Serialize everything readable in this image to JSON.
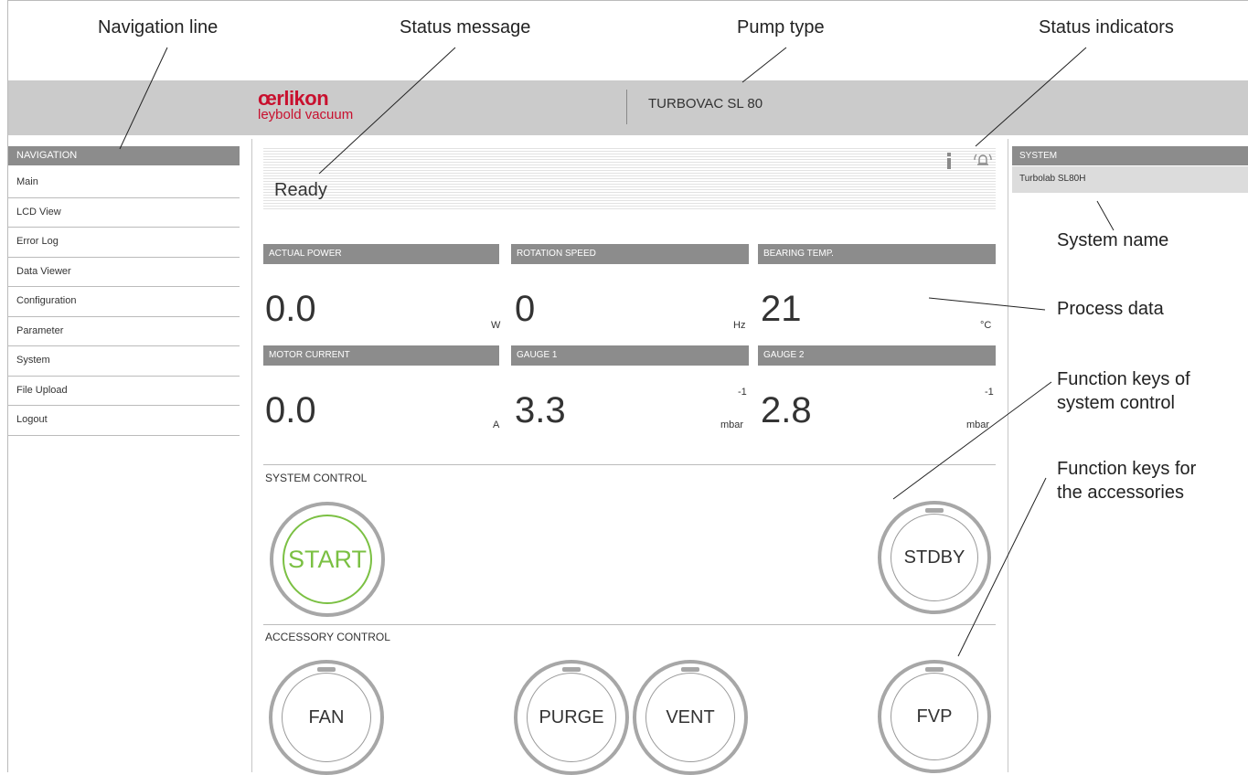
{
  "callouts": {
    "navigation_line": "Navigation line",
    "status_message": "Status message",
    "pump_type": "Pump type",
    "status_indicators": "Status indicators",
    "system_name": "System name",
    "process_data": "Process data",
    "function_keys_system_1": "Function keys of",
    "function_keys_system_2": "system control",
    "function_keys_acc_1": "Function keys for",
    "function_keys_acc_2": "the accessories"
  },
  "header": {
    "logo_top": "œrlikon",
    "logo_bottom": "leybold vacuum",
    "pump_type": "TURBOVAC SL 80"
  },
  "navigation": {
    "title": "NAVIGATION",
    "items": [
      "Main",
      "LCD View",
      "Error Log",
      "Data Viewer",
      "Configuration",
      "Parameter",
      "System",
      "File Upload",
      "Logout"
    ]
  },
  "status": {
    "message": "Ready",
    "info_icon": "info-icon",
    "alarm_icon": "alarm-icon"
  },
  "process_data": {
    "actual_power": {
      "label": "ACTUAL POWER",
      "value": "0.0",
      "unit": "W"
    },
    "rotation_speed": {
      "label": "ROTATION SPEED",
      "value": "0",
      "unit": "Hz"
    },
    "bearing_temp": {
      "label": "BEARING TEMP.",
      "value": "21",
      "unit": "°C"
    },
    "motor_current": {
      "label": "MOTOR CURRENT",
      "value": "0.0",
      "unit": "A"
    },
    "gauge1": {
      "label": "GAUGE 1",
      "value": "3.3",
      "exponent": "-1",
      "unit": "mbar"
    },
    "gauge2": {
      "label": "GAUGE 2",
      "value": "2.8",
      "exponent": "-1",
      "unit": "mbar"
    }
  },
  "system_control": {
    "title": "SYSTEM CONTROL",
    "start_label": "START",
    "standby_label": "STDBY"
  },
  "accessory_control": {
    "title": "ACCESSORY CONTROL",
    "fan_label": "FAN",
    "purge_label": "PURGE",
    "vent_label": "VENT",
    "fvp_label": "FVP"
  },
  "system": {
    "title": "SYSTEM",
    "name": "Turbolab SL80H"
  },
  "colors": {
    "brand": "#c8102e",
    "start_green": "#7bc043",
    "header_bg": "#cbcbcb",
    "label_bg": "#8c8c8c"
  }
}
